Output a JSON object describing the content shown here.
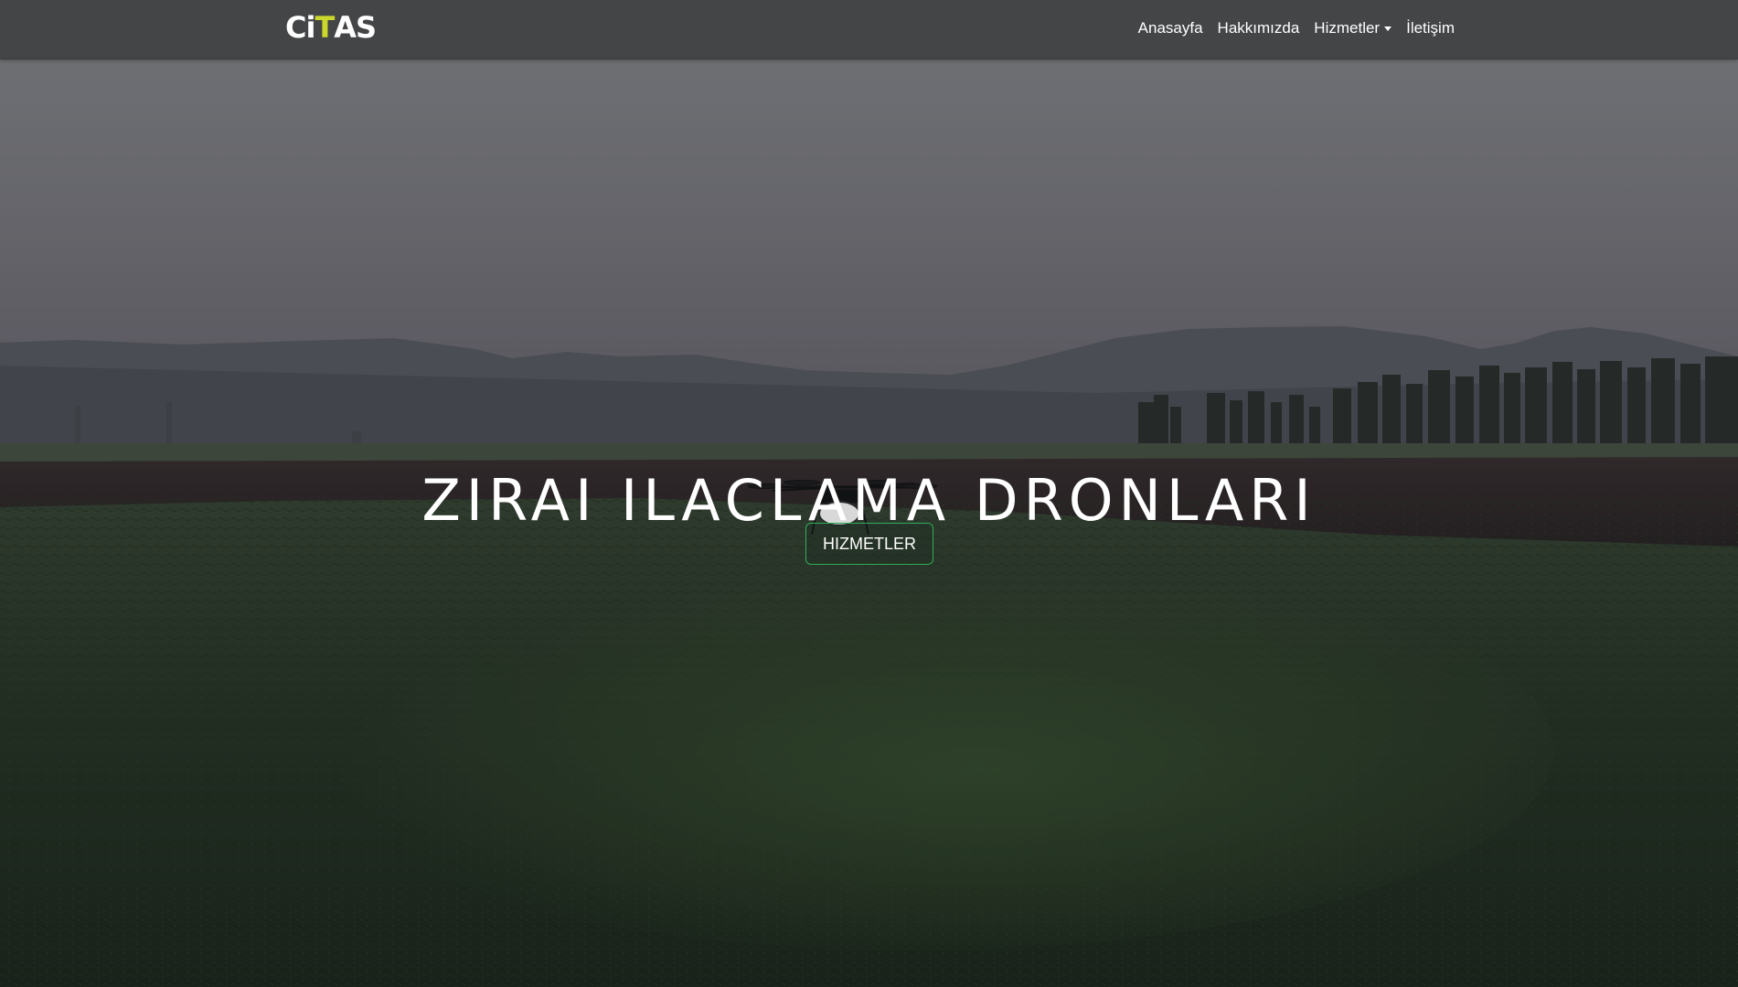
{
  "brand": {
    "logo_letters": [
      "C",
      "i",
      "T",
      "A",
      "S"
    ],
    "accent_letter_index": 2,
    "accent_color": "#c9d82a"
  },
  "nav": {
    "items": [
      {
        "label": "Anasayfa",
        "has_dropdown": false
      },
      {
        "label": "Hakkımızda",
        "has_dropdown": false
      },
      {
        "label": "Hizmetler",
        "has_dropdown": true
      },
      {
        "label": "İletişim",
        "has_dropdown": false
      }
    ]
  },
  "hero": {
    "title": "ZIRAI ILACLAMA DRONLARI",
    "button_label": "HIZMETLER",
    "button_border_color": "#2fae5a"
  },
  "icons": {
    "dropdown": "chevron-down-icon"
  }
}
